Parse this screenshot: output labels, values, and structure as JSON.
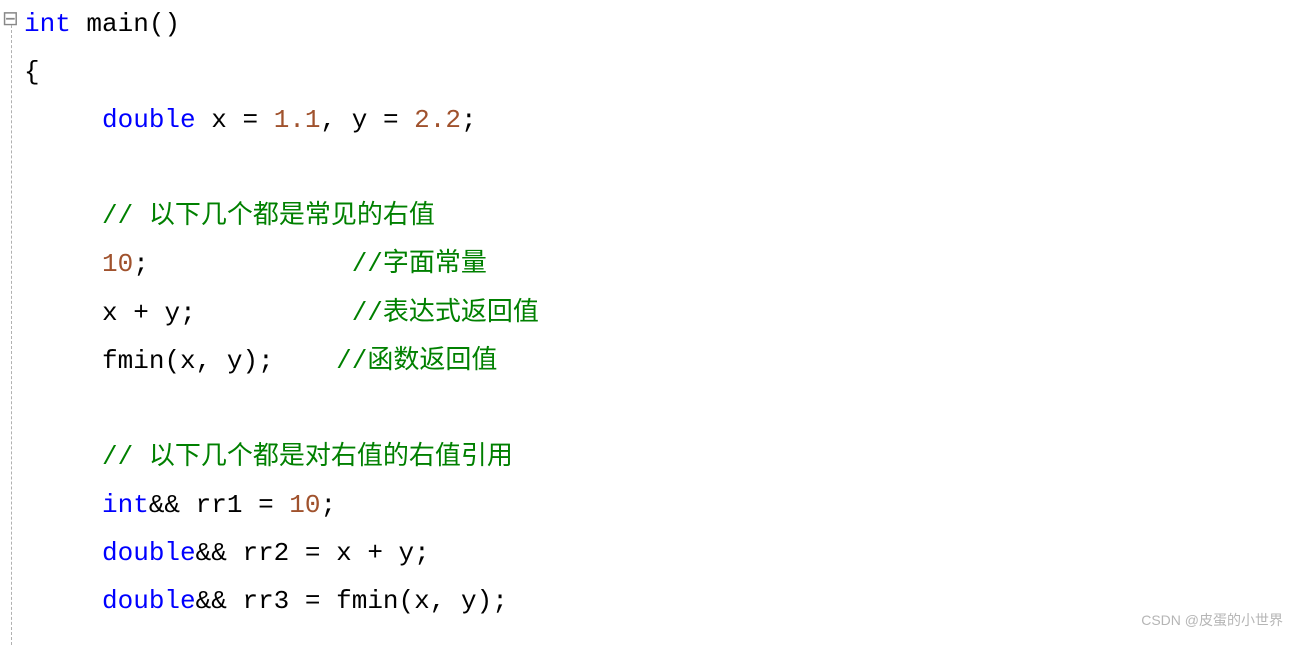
{
  "code": {
    "line1": {
      "kw_int": "int",
      "fn_main": "main",
      "parens": "()"
    },
    "line2": {
      "brace": "{"
    },
    "line3": {
      "kw_double": "double",
      "var_x": "x",
      "eq1": "=",
      "num1": "1.1",
      "comma1": ",",
      "var_y": "y",
      "eq2": "=",
      "num2": "2.2",
      "semi": ";"
    },
    "line5": {
      "comment": "// 以下几个都是常见的右值"
    },
    "line6": {
      "num10": "10",
      "semi": ";",
      "comment": "//字面常量"
    },
    "line7": {
      "var_x": "x",
      "plus": "+",
      "var_y": "y",
      "semi": ";",
      "comment": "//表达式返回值"
    },
    "line8": {
      "fn": "fmin",
      "lparen": "(",
      "var_x": "x",
      "comma": ",",
      "var_y": "y",
      "rparen": ")",
      "semi": ";",
      "comment": "//函数返回值"
    },
    "line10": {
      "comment": "// 以下几个都是对右值的右值引用"
    },
    "line11": {
      "kw_int": "int",
      "amp": "&&",
      "var": "rr1",
      "eq": "=",
      "num": "10",
      "semi": ";"
    },
    "line12": {
      "kw_double": "double",
      "amp": "&&",
      "var": "rr2",
      "eq": "=",
      "var_x": "x",
      "plus": "+",
      "var_y": "y",
      "semi": ";"
    },
    "line13": {
      "kw_double": "double",
      "amp": "&&",
      "var": "rr3",
      "eq": "=",
      "fn": "fmin",
      "lparen": "(",
      "var_x": "x",
      "comma": ",",
      "var_y": "y",
      "rparen": ")",
      "semi": ";"
    }
  },
  "fold_marker": "⊟",
  "watermark": "CSDN @皮蛋的小世界"
}
